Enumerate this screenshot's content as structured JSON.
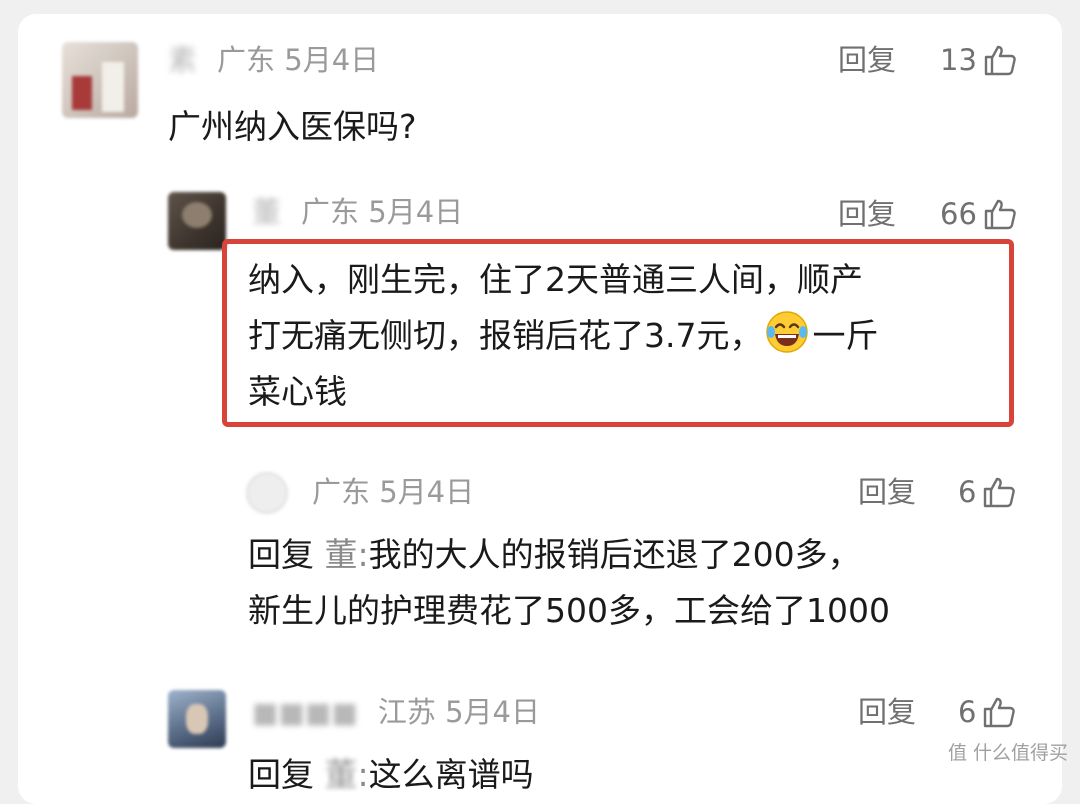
{
  "comments": [
    {
      "location": "广东",
      "date": "5月4日",
      "reply_label": "回复",
      "likes": "13",
      "text": "广州纳入医保吗?"
    },
    {
      "location": "广东",
      "date": "5月4日",
      "reply_label": "回复",
      "likes": "66",
      "text_lines": [
        "纳入，刚生完，住了2天普通三人间，顺产",
        "打无痛无侧切，报销后花了3.7元，",
        "一斤",
        "菜心钱"
      ]
    },
    {
      "location": "广东",
      "date": "5月4日",
      "reply_label": "回复",
      "likes": "6",
      "reply_prefix": "回复",
      "reply_target": "董",
      "reply_colon": ":",
      "text_line1": "我的大人的报销后还退了200多，",
      "text_line2": "新生儿的护理费花了500多，工会给了1000"
    },
    {
      "location": "江苏",
      "date": "5月4日",
      "reply_label": "回复",
      "likes": "6",
      "reply_prefix": "回复",
      "reply_colon": ":",
      "text": "这么离谱吗"
    }
  ],
  "watermark": "值 什么值得买",
  "colors": {
    "highlight_border": "#d9443a",
    "meta": "#9a9a9a",
    "text": "#1a1a1a"
  }
}
